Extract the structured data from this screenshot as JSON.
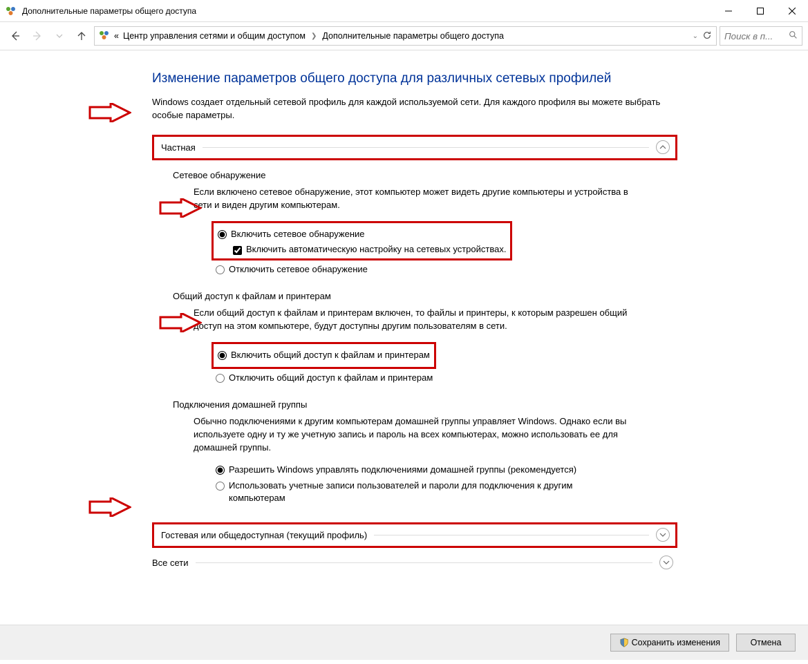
{
  "window_title": "Дополнительные параметры общего доступа",
  "breadcrumbs": {
    "prefix": "«",
    "item1": "Центр управления сетями и общим доступом",
    "item2": "Дополнительные параметры общего доступа"
  },
  "search": {
    "placeholder": "Поиск в п..."
  },
  "page": {
    "title": "Изменение параметров общего доступа для различных сетевых профилей",
    "subtitle": "Windows создает отдельный сетевой профиль для каждой используемой сети. Для каждого профиля вы можете выбрать особые параметры."
  },
  "profiles": {
    "private": "Частная",
    "guest": "Гостевая или общедоступная (текущий профиль)",
    "all": "Все сети"
  },
  "network_discovery": {
    "heading": "Сетевое обнаружение",
    "desc": "Если включено сетевое обнаружение, этот компьютер может видеть другие компьютеры и устройства в сети и виден другим компьютерам.",
    "on": "Включить сетевое обнаружение",
    "autoconf": "Включить автоматическую настройку на сетевых устройствах.",
    "off": "Отключить сетевое обнаружение"
  },
  "file_printer": {
    "heading": "Общий доступ к файлам и принтерам",
    "desc": "Если общий доступ к файлам и принтерам включен, то файлы и принтеры, к которым разрешен общий доступ на этом компьютере, будут доступны другим пользователям в сети.",
    "on": "Включить общий доступ к файлам и принтерам",
    "off": "Отключить общий доступ к файлам и принтерам"
  },
  "homegroup": {
    "heading": "Подключения домашней группы",
    "desc": "Обычно подключениями к другим компьютерам домашней группы управляет Windows. Однако если вы используете одну и ту же учетную запись и пароль на всех компьютерах, можно использовать ее для домашней группы.",
    "opt1": "Разрешить Windows управлять подключениями домашней группы (рекомендуется)",
    "opt2": "Использовать учетные записи пользователей и пароли для подключения к другим компьютерам"
  },
  "buttons": {
    "save": "Сохранить изменения",
    "cancel": "Отмена"
  }
}
